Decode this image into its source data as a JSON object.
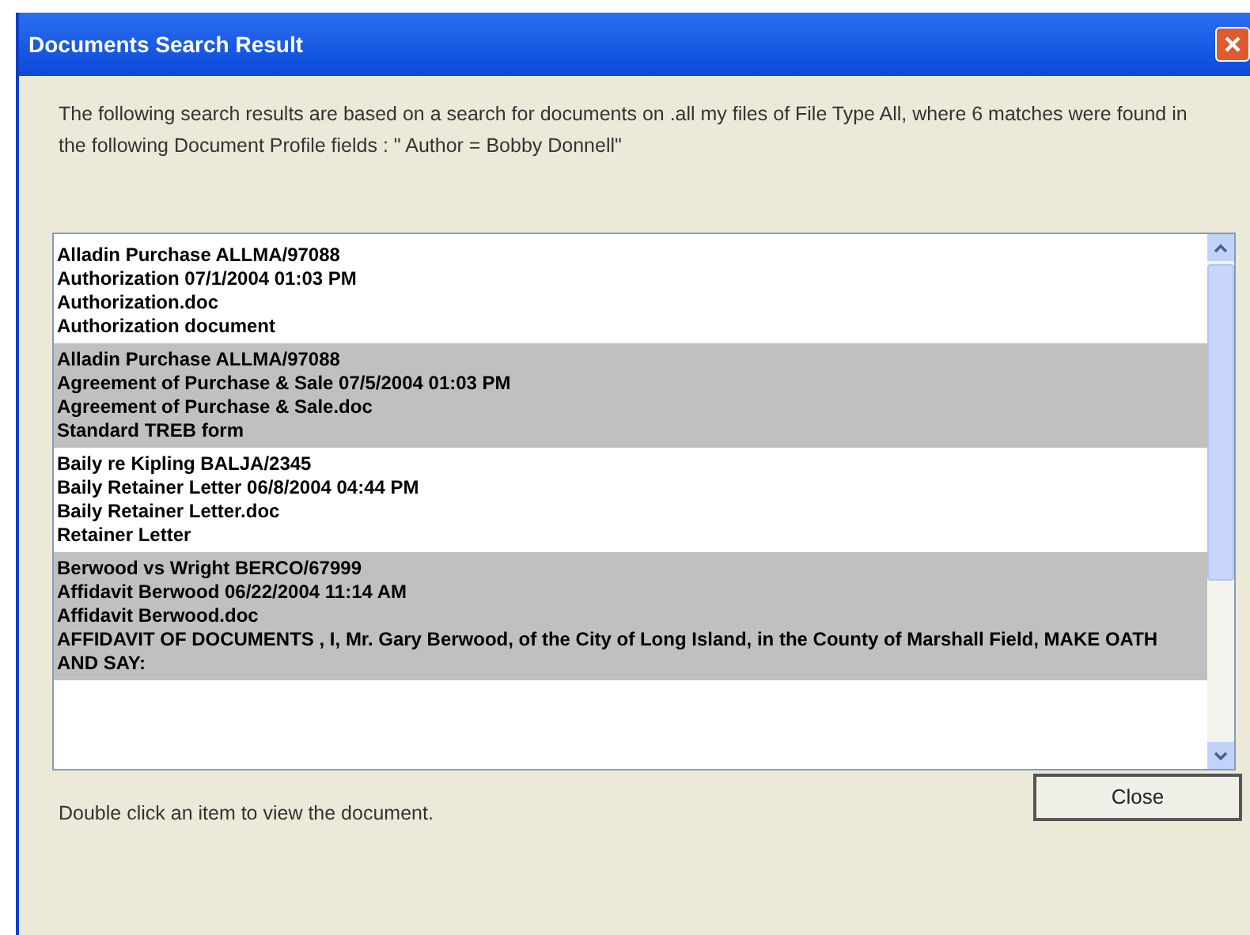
{
  "window": {
    "title": "Documents Search Result"
  },
  "message": "The following search results are based on a search for documents on .all my files of File Type All, where 6 matches were found in the following Document Profile fields : \" Author = Bobby Donnell\"",
  "results": [
    {
      "shaded": false,
      "lines": [
        "Alladin Purchase ALLMA/97088",
        "Authorization 07/1/2004 01:03 PM",
        "Authorization.doc",
        "Authorization document"
      ]
    },
    {
      "shaded": true,
      "lines": [
        "Alladin Purchase ALLMA/97088",
        "Agreement of Purchase & Sale 07/5/2004 01:03 PM",
        "Agreement of Purchase & Sale.doc",
        "Standard TREB form"
      ]
    },
    {
      "shaded": false,
      "lines": [
        "Baily re Kipling BALJA/2345",
        "Baily Retainer Letter 06/8/2004 04:44 PM",
        "Baily Retainer Letter.doc",
        "Retainer Letter"
      ]
    },
    {
      "shaded": true,
      "lines": [
        "Berwood vs Wright BERCO/67999",
        "Affidavit Berwood 06/22/2004 11:14 AM",
        "Affidavit Berwood.doc",
        "AFFIDAVIT OF DOCUMENTS , I, Mr. Gary Berwood, of the City of Long Island, in the County of Marshall Field, MAKE OATH AND SAY:"
      ]
    }
  ],
  "hint": "Double click an item to view the document.",
  "buttons": [
    "Close"
  ]
}
